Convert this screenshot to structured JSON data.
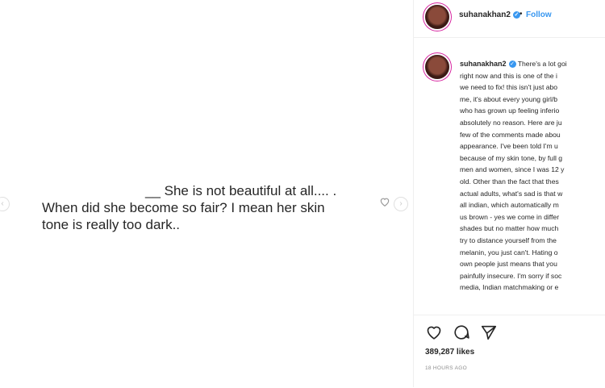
{
  "post_image": {
    "lines": [
      "__ She is not beautiful at all.... .",
      "When did she become so fair? I mean her skin",
      "tone is really too dark.."
    ]
  },
  "header": {
    "username": "suhanakhan2",
    "separator": "•",
    "follow_label": "Follow"
  },
  "caption": {
    "username": "suhanakhan2",
    "lines": [
      "There's a lot goi",
      "right now and this is one of the i",
      "we need to fix! this isn't just abo",
      "me, it's about every young girl/b",
      "who has grown up feeling inferio",
      "absolutely no reason. Here are ju",
      "few of the comments made abou",
      "appearance. I've been told I'm u",
      "because of my skin tone, by full g",
      "men and women, since I was 12 y",
      "old. Other than the fact that thes",
      "actual adults, what's sad is that w",
      "all indian, which automatically m",
      "us brown - yes we come in differ",
      "shades but no matter how much",
      "try to distance yourself from the",
      "melanin, you just can't. Hating o",
      "own people just means that you",
      "painfully insecure. I'm sorry if soc",
      "media, Indian matchmaking or e"
    ]
  },
  "actions": {
    "likes": "389,287 likes",
    "time_ago": "18 HOURS AGO"
  },
  "icons": {
    "like": "heart-icon",
    "comment": "comment-icon",
    "share": "share-icon",
    "verified": "verified-badge-icon",
    "prev": "chevron-left-icon",
    "next": "chevron-right-icon"
  },
  "colors": {
    "accent": "#3897f0",
    "text": "#262626",
    "muted": "#8e8e8e"
  }
}
